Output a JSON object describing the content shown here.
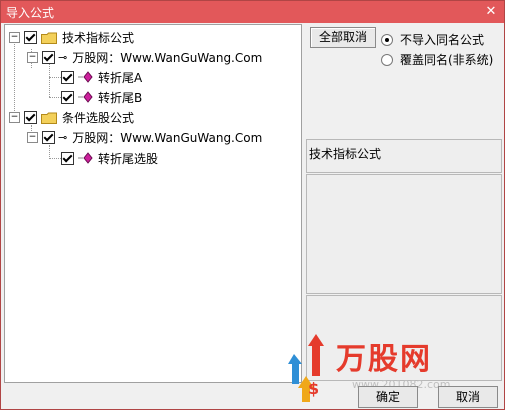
{
  "window": {
    "title": "导入公式",
    "close_symbol": "✕"
  },
  "tree": {
    "groups": [
      {
        "label": "技术指标公式",
        "source": "万股网：Www.WanGuWang.Com",
        "items": [
          "转折尾A",
          "转折尾B"
        ]
      },
      {
        "label": "条件选股公式",
        "source": "万股网：Www.WanGuWang.Com",
        "items": [
          "转折尾选股"
        ]
      }
    ],
    "expander_symbol": "−"
  },
  "options": {
    "deselect_all_label": "全部取消",
    "radio_no_import_same_name": "不导入同名公式",
    "radio_overwrite_same_name": "覆盖同名(非系统)",
    "selected_radio": "不导入同名公式"
  },
  "info": {
    "formula_type": "技术指标公式"
  },
  "footer": {
    "confirm_label": "确定",
    "cancel_label": "取消"
  },
  "watermark": {
    "brand": "万股网",
    "url": "www.201082.com"
  },
  "colors": {
    "titlebar": "#e2585a",
    "brand_red": "#e53b2c",
    "diamond": "#cc1f9c",
    "folder": "#f3d05a"
  }
}
